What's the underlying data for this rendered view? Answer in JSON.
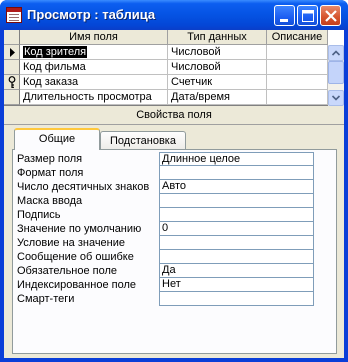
{
  "window": {
    "title": "Просмотр : таблица",
    "accent": "#0553e3",
    "close_color": "#d5532d"
  },
  "grid": {
    "columns": [
      "Имя поля",
      "Тип данных",
      "Описание"
    ],
    "rows": [
      {
        "name": "Код зрителя",
        "type": "Числовой",
        "description": "",
        "marker": "current-row-arrow"
      },
      {
        "name": "Код фильма",
        "type": "Числовой",
        "description": "",
        "marker": ""
      },
      {
        "name": "Код заказа",
        "type": "Счетчик",
        "description": "",
        "marker": "primary-key-icon"
      },
      {
        "name": "Длительность просмотра",
        "type": "Дата/время",
        "description": "",
        "marker": ""
      }
    ]
  },
  "field_properties": {
    "section_title": "Свойства поля",
    "tabs": [
      {
        "label": "Общие",
        "active": true
      },
      {
        "label": "Подстановка",
        "active": false
      }
    ],
    "properties": [
      {
        "label": "Размер поля",
        "value": "Длинное целое"
      },
      {
        "label": "Формат поля",
        "value": ""
      },
      {
        "label": "Число десятичных знаков",
        "value": "Авто"
      },
      {
        "label": "Маска ввода",
        "value": ""
      },
      {
        "label": "Подпись",
        "value": ""
      },
      {
        "label": "Значение по умолчанию",
        "value": "0"
      },
      {
        "label": "Условие на значение",
        "value": ""
      },
      {
        "label": "Сообщение об ошибке",
        "value": ""
      },
      {
        "label": "Обязательное поле",
        "value": "Да"
      },
      {
        "label": "Индексированное поле",
        "value": "Нет"
      },
      {
        "label": "Смарт-теги",
        "value": ""
      }
    ]
  }
}
